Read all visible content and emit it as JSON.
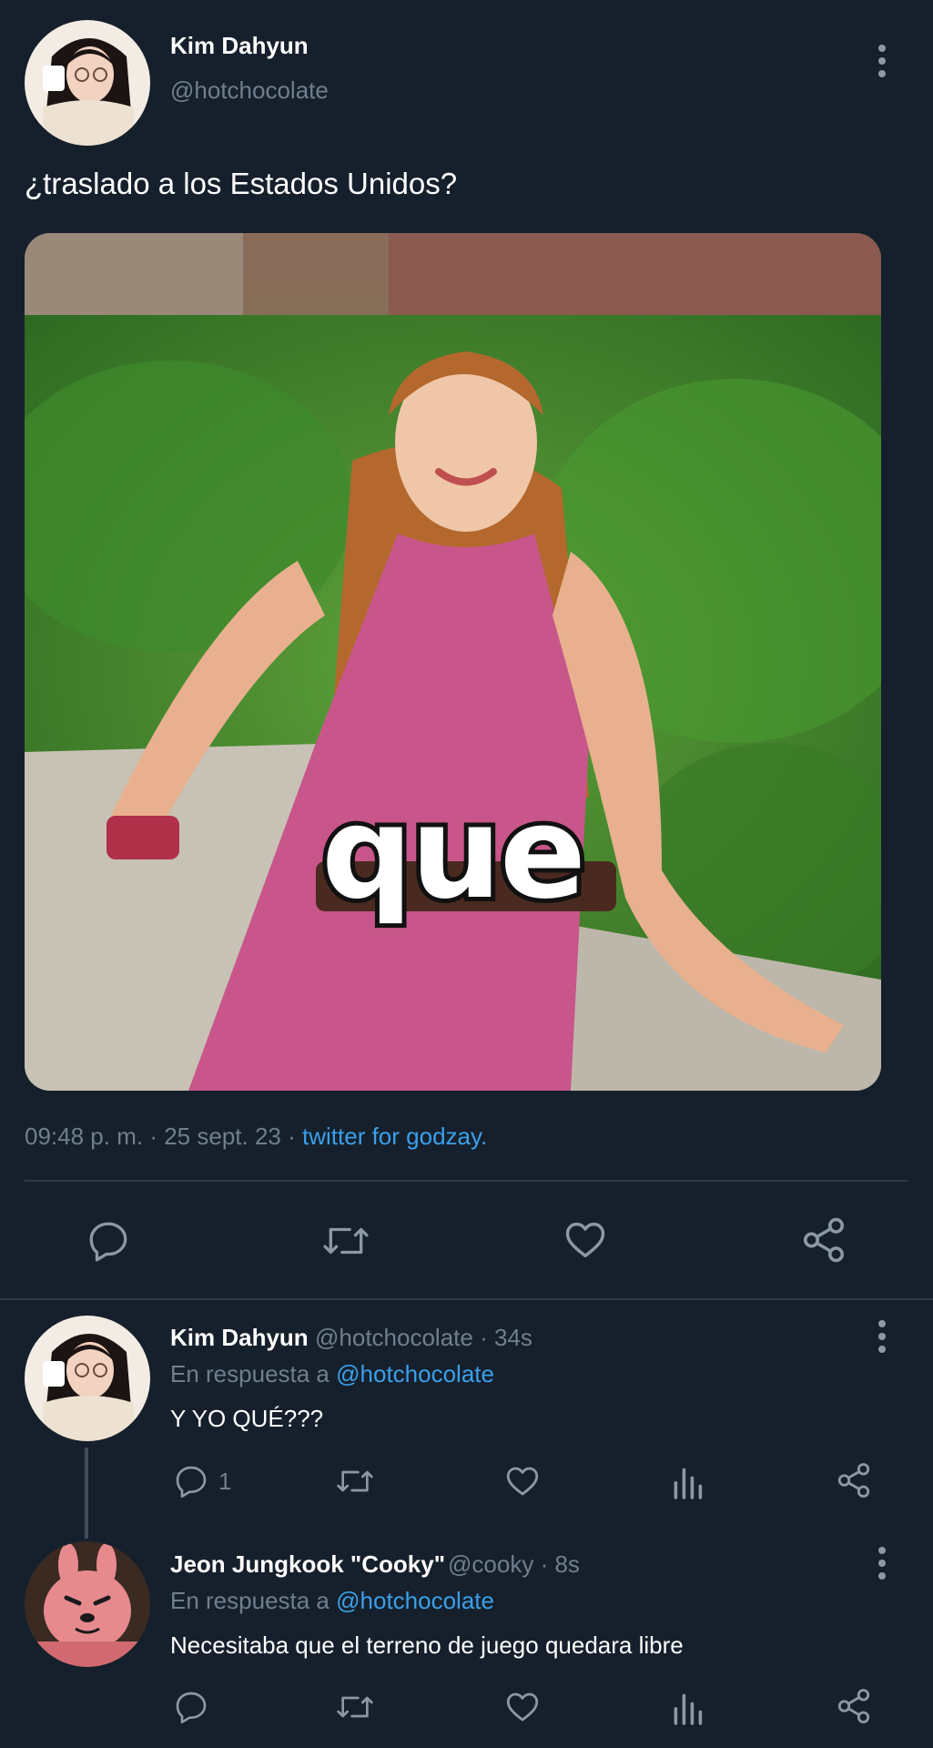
{
  "main_tweet": {
    "author_name": "Kim Dahyun",
    "author_handle": "@hotchocolate",
    "text": "¿traslado a los Estados Unidos?",
    "media_caption": "que",
    "time": "09:48 p. m.",
    "date": "25 sept. 23",
    "separator": "·",
    "source": "twitter for godzay."
  },
  "replies": [
    {
      "author_name": "Kim Dahyun",
      "author_handle": "@hotchocolate",
      "age": "34s",
      "reply_prefix": "En respuesta a",
      "reply_to": "@hotchocolate",
      "text": "Y YO QUÉ???",
      "reply_count": "1"
    },
    {
      "author_name": "Jeon Jungkook \"Cooky\"",
      "author_handle": "@cooky",
      "age": "8s",
      "reply_prefix": "En respuesta a",
      "reply_to": "@hotchocolate",
      "text": "Necesitaba que el terreno de juego quedara libre",
      "reply_count": ""
    }
  ],
  "icons": [
    "more-icon",
    "reply-icon",
    "retweet-icon",
    "like-icon",
    "share-icon",
    "analytics-icon"
  ],
  "colors": {
    "background": "#16202c",
    "link": "#3aa0ea",
    "muted": "#6f7f8e",
    "icon": "#8b98a5"
  }
}
